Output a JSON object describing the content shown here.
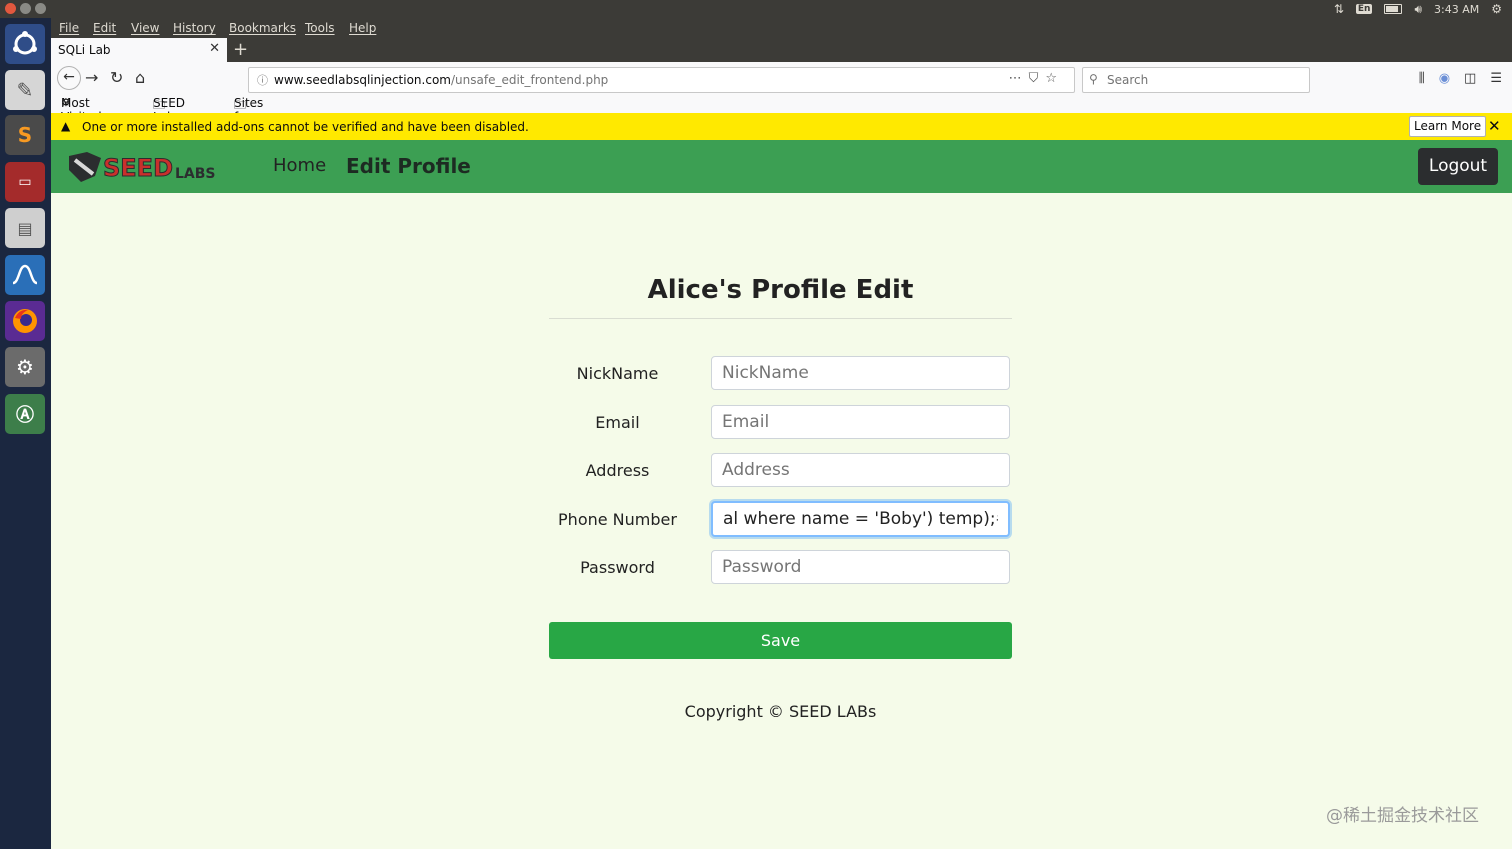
{
  "system": {
    "clock": "3:43 AM",
    "keyboard_layout": "En"
  },
  "menu": [
    "File",
    "Edit",
    "View",
    "History",
    "Bookmarks",
    "Tools",
    "Help"
  ],
  "tab": {
    "title": "SQLi Lab"
  },
  "url": {
    "domain": "www.seedlabsqlinjection.com",
    "path": "/unsafe_edit_frontend.php"
  },
  "search": {
    "placeholder": "Search"
  },
  "bookmarks": [
    "Most Visited",
    "SEED Labs",
    "Sites for Labs"
  ],
  "notification": {
    "message": "One or more installed add-ons cannot be verified and have been disabled.",
    "learn_more": "Learn More"
  },
  "site": {
    "logo_text": "SEED LABS",
    "nav": {
      "home": "Home",
      "edit_profile": "Edit Profile",
      "logout": "Logout"
    },
    "title": "Alice's Profile Edit",
    "form": {
      "nickname": {
        "label": "NickName",
        "placeholder": "NickName",
        "value": ""
      },
      "email": {
        "label": "Email",
        "placeholder": "Email",
        "value": ""
      },
      "address": {
        "label": "Address",
        "placeholder": "Address",
        "value": ""
      },
      "phone": {
        "label": "Phone Number",
        "placeholder": "",
        "value": "al where name = 'Boby') temp);#"
      },
      "password": {
        "label": "Password",
        "placeholder": "Password",
        "value": ""
      },
      "save": "Save"
    },
    "footer": "Copyright © SEED LABs"
  },
  "watermark": "@稀土掘金技术社区",
  "colors": {
    "nav_green": "#3c9f53",
    "save_green": "#28a745",
    "page_bg": "#f5fbe9",
    "notif_yellow": "#ffe900"
  }
}
